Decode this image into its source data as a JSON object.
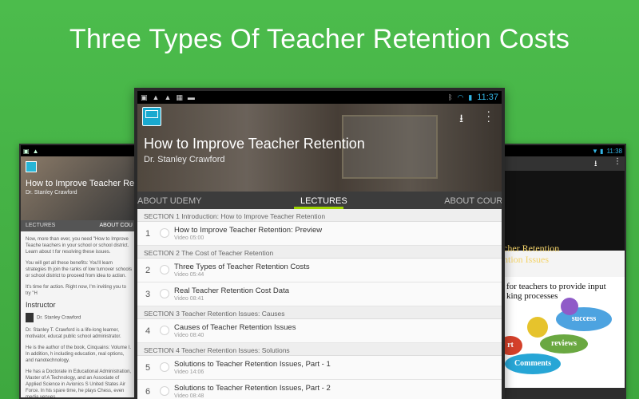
{
  "headline": "Three Types Of Teacher Retention Costs",
  "main": {
    "status_time": "11:37",
    "course_title": "How to Improve Teacher Retention",
    "author": "Dr. Stanley Crawford",
    "tabs": [
      "ABOUT UDEMY",
      "LECTURES",
      "ABOUT COURSE"
    ],
    "sections": [
      {
        "label": "SECTION 1  Introduction:  How to Improve Teacher Retention",
        "lectures": [
          {
            "num": "1",
            "title": "How to Improve Teacher Retention:  Preview",
            "meta": "Video 05:00"
          }
        ]
      },
      {
        "label": "SECTION 2  The Cost of Teacher Retention",
        "lectures": [
          {
            "num": "2",
            "title": "Three Types of Teacher Retention Costs",
            "meta": "Video 05:44"
          },
          {
            "num": "3",
            "title": "Real Teacher Retention Cost Data",
            "meta": "Video 08:41"
          }
        ]
      },
      {
        "label": "SECTION 3  Teacher Retention Issues:  Causes",
        "lectures": [
          {
            "num": "4",
            "title": "Causes of Teacher Retention Issues",
            "meta": "Video 08:40"
          }
        ]
      },
      {
        "label": "SECTION 4  Teacher Retention Issues:  Solutions",
        "lectures": [
          {
            "num": "5",
            "title": "Solutions to Teacher Retention Issues, Part - 1",
            "meta": "Video 14:06"
          },
          {
            "num": "6",
            "title": "Solutions to Teacher Retention Issues, Part - 2",
            "meta": "Video 08:48"
          }
        ]
      }
    ]
  },
  "left": {
    "title": "How to Improve Teacher Reten",
    "author": "Dr. Stanley Crawford",
    "tabs": [
      "LECTURES",
      "ABOUT COU"
    ],
    "p1": "Now, more than ever, you need \"How to Improve Teache teachers in your school or school district. Learn about t for resolving these issues.",
    "p2": "You will get all these benefits: You'll learn strategies th join the ranks of low turnover schools or school district to proceed from idea to action.",
    "p3": "It's time for action. Right now, I'm inviting you to try \"H",
    "instructor_heading": "Instructor",
    "instructor_name": "Dr. Stanley Crawford",
    "p4": "Dr. Stanley T. Crawford is a life-long learner, motivator, educat public school administrator.",
    "p5": "He is the author of the book, Cinquains: Volume I. In addition, h including education, real options, and nanotechnology.",
    "p6": "He has a Doctorate in Educational Administration, Master of A Technology, and an Associate of Applied Science in Avionics S United States Air Force. In his spare time, he plays Chess, even media venues."
  },
  "right": {
    "time": "11:38",
    "line1": "cher Retention",
    "line2": "ntion Issues",
    "slide_l1": "for teachers to provide input",
    "slide_l2": "king processes",
    "gear1": "success",
    "gear2": "reviews",
    "gear3": "Comments",
    "gear4": "rt"
  }
}
